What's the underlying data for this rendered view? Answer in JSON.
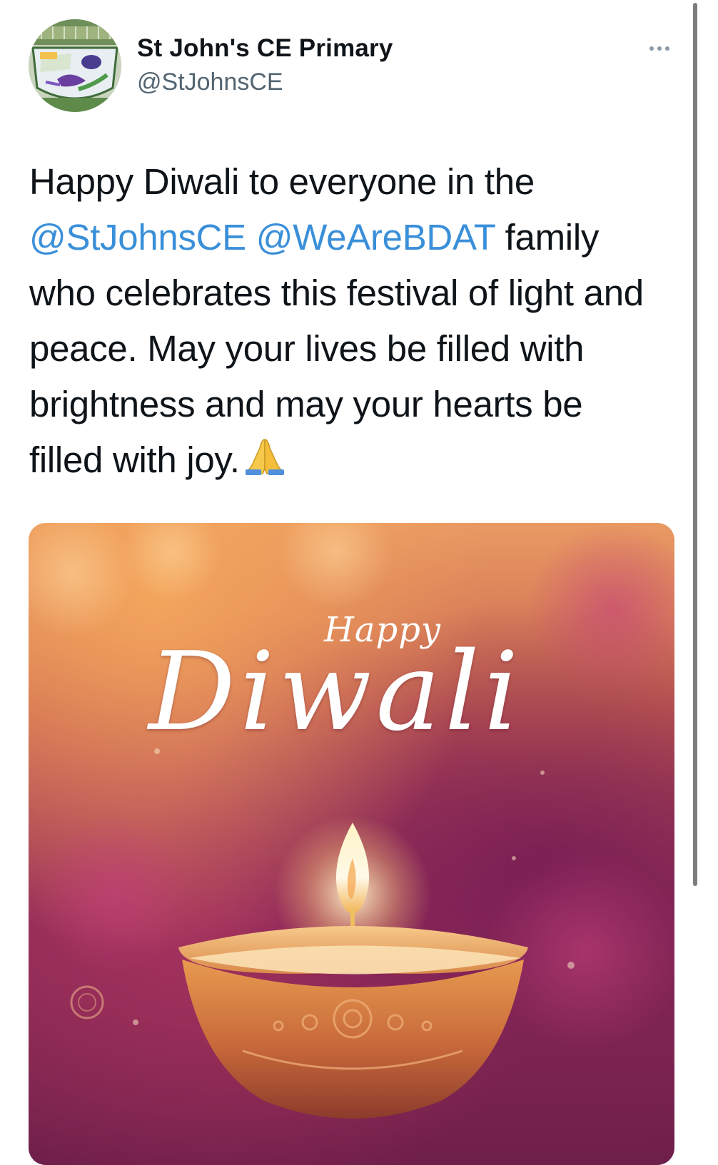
{
  "author": {
    "name": "St John's CE Primary",
    "handle": "@StJohnsCE",
    "avatar_icon": "school-crest-avatar"
  },
  "more_icon": "more-horizontal-icon",
  "tweet": {
    "text_1": "Happy Diwali to everyone in the ",
    "mention_1": "@StJohnsCE",
    "text_2": " ",
    "mention_2": "@WeAreBDAT",
    "text_3": " family who celebrates this festival of light and peace. May your lives be filled with brightness and may your hearts be filled with joy.",
    "emoji": "folded-hands-icon"
  },
  "media": {
    "caption_small": "Happy",
    "caption_big": "Diwali",
    "image_subject": "diya-lamp-icon"
  },
  "colors": {
    "mention": "#3a8fd9",
    "handle": "#536471",
    "text": "#0f1419"
  }
}
